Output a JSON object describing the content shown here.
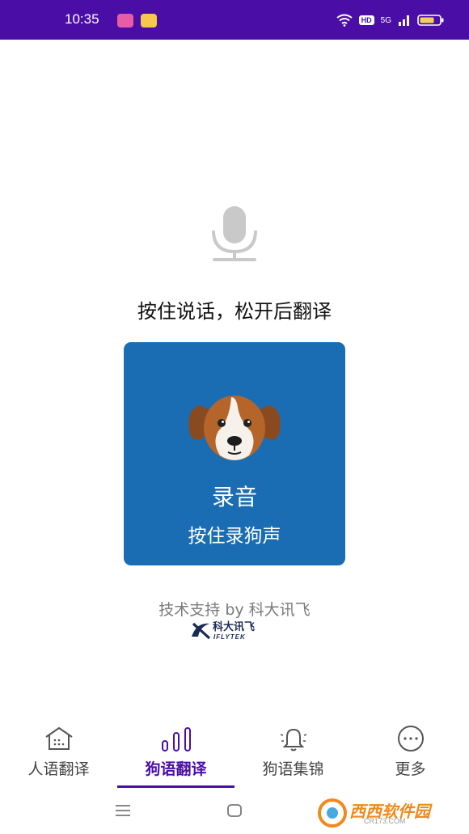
{
  "status_bar": {
    "time": "10:35",
    "hd_badge": "HD",
    "network": "5G",
    "notification_icons": [
      "app-notification-icon",
      "message-notification-icon"
    ],
    "icons": [
      "wifi-icon",
      "signal-icon",
      "battery-icon"
    ]
  },
  "main": {
    "mic_icon": "microphone-icon",
    "prompt": "按住说话，松开后翻译",
    "record_card": {
      "icon": "dog-icon",
      "title": "录音",
      "subtitle": "按住录狗声",
      "background": "#1a6db3"
    },
    "powered_by": "技术支持 by 科大讯飞",
    "logo_text": "科大讯飞",
    "logo_subtext": "IFLYTEK"
  },
  "tabs": [
    {
      "label": "人语翻译",
      "icon": "house-icon",
      "active": false
    },
    {
      "label": "狗语翻译",
      "icon": "sound-bars-icon",
      "active": true
    },
    {
      "label": "狗语集锦",
      "icon": "bell-icon",
      "active": false
    },
    {
      "label": "更多",
      "icon": "more-dots-icon",
      "active": false
    }
  ],
  "watermark": {
    "text": "西西软件园",
    "subtext": "CR173.COM"
  },
  "colors": {
    "accent": "#4a0ea6",
    "card": "#1a6db3",
    "muted_text": "#7a7a7a"
  }
}
